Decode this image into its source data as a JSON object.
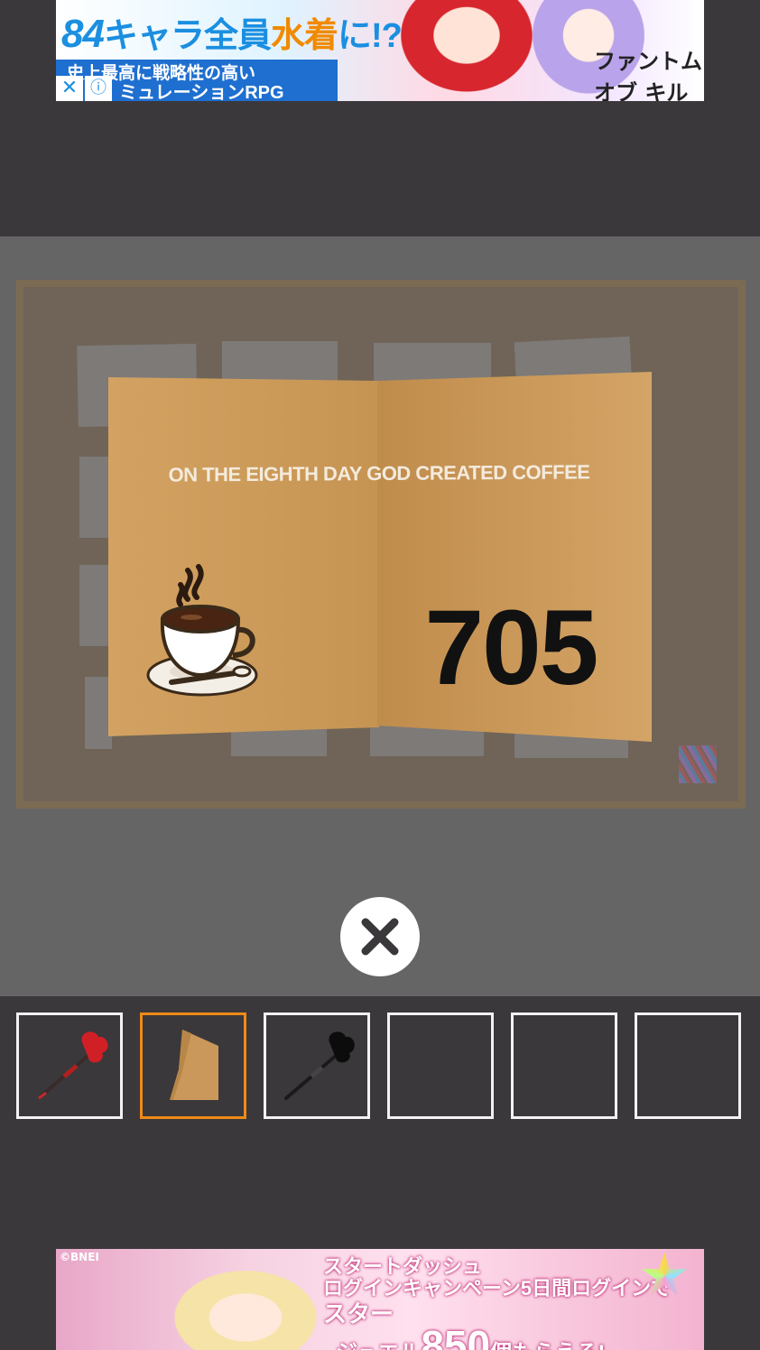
{
  "ads": {
    "top": {
      "line1_number": "84",
      "line1_text": "キャラ全員",
      "line1_highlight": "水着",
      "line1_suffix": "に!?",
      "line2": "史上最高に戦略性の高い",
      "line3": "ミュレーションRPG",
      "logo": "ファントム オブ キル",
      "close_icon": "close-icon",
      "info_icon": "info-icon"
    },
    "bottom": {
      "copyright": "©BNEI",
      "line1": "スタートダッシュ",
      "line2": "ログインキャンペーン5日間ログインで",
      "line3_prefix": "スター",
      "line3_number": "850",
      "line3_suffix": "個",
      "line4": "ジュエル",
      "line4_suffix": "もらえる!"
    }
  },
  "card": {
    "message": "ON THE EIGHTH DAY GOD CREATED COFFEE",
    "number": "705",
    "icon": "coffee-cup-icon"
  },
  "controls": {
    "close_icon": "close-icon"
  },
  "inventory": {
    "slots": [
      {
        "item": "red-dart",
        "selected": false
      },
      {
        "item": "card",
        "selected": true
      },
      {
        "item": "black-dart",
        "selected": false
      },
      {
        "item": "",
        "selected": false
      },
      {
        "item": "",
        "selected": false
      },
      {
        "item": "",
        "selected": false
      }
    ]
  },
  "colors": {
    "background": "#3a383b",
    "selected_slot": "#f08a18",
    "card": "#c9985a"
  }
}
